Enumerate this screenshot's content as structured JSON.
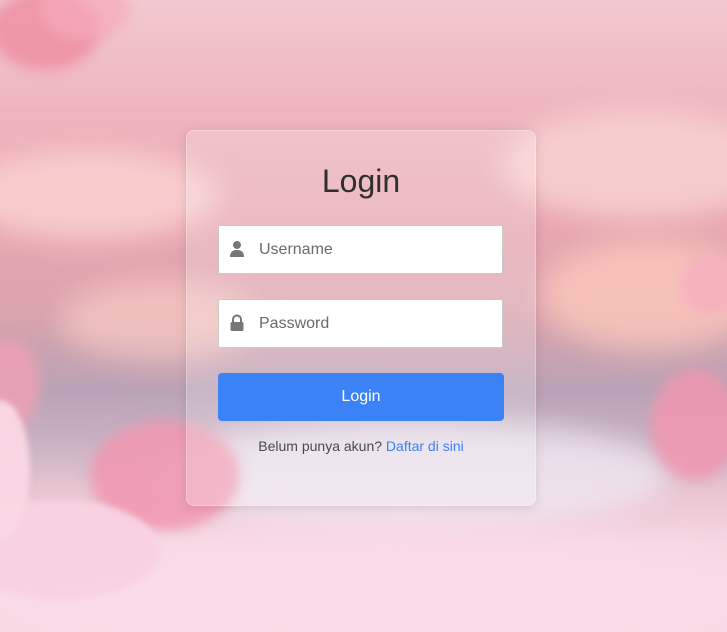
{
  "login": {
    "title": "Login",
    "username_placeholder": "Username",
    "password_placeholder": "Password",
    "submit_label": "Login",
    "register_prompt": "Belum punya akun?",
    "register_link": "Daftar di sini"
  },
  "colors": {
    "button": "#3b82f6",
    "link": "#3b82f6",
    "background": "#eeb4bd"
  },
  "icons": {
    "username": "user-icon",
    "password": "lock-icon"
  }
}
